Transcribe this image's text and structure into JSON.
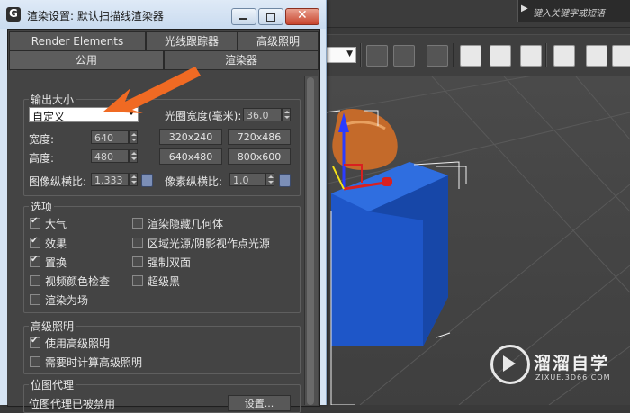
{
  "dialog": {
    "title": "渲染设置: 默认扫描线渲染器",
    "tabs_row1": [
      "Render Elements",
      "光线跟踪器",
      "高级照明"
    ],
    "tabs_row2": [
      "公用",
      "渲染器"
    ]
  },
  "output_size": {
    "group_title": "输出大小",
    "preset": "自定义",
    "aperture_label": "光圈宽度(毫米):",
    "aperture_value": "36.0",
    "width_label": "宽度:",
    "width_value": "640",
    "height_label": "高度:",
    "height_value": "480",
    "presets": [
      "320x240",
      "720x486",
      "640x480",
      "800x600"
    ],
    "image_aspect_label": "图像纵横比:",
    "image_aspect_value": "1.333",
    "pixel_aspect_label": "像素纵横比:",
    "pixel_aspect_value": "1.0"
  },
  "options": {
    "group_title": "选项",
    "left": [
      {
        "label": "大气",
        "checked": true
      },
      {
        "label": "效果",
        "checked": true
      },
      {
        "label": "置换",
        "checked": true
      },
      {
        "label": "视频颜色检查",
        "checked": false
      },
      {
        "label": "渲染为场",
        "checked": false
      }
    ],
    "right": [
      {
        "label": "渲染隐藏几何体",
        "checked": false
      },
      {
        "label": "区域光源/阴影视作点光源",
        "checked": false
      },
      {
        "label": "强制双面",
        "checked": false
      },
      {
        "label": "超级黑",
        "checked": false
      }
    ]
  },
  "advanced_lighting": {
    "group_title": "高级照明",
    "items": [
      {
        "label": "使用高级照明",
        "checked": true
      },
      {
        "label": "需要时计算高级照明",
        "checked": false
      }
    ]
  },
  "bitmap_proxy": {
    "group_title": "位图代理",
    "status": "位图代理已被禁用",
    "setup_button": "设置..."
  },
  "topbar": {
    "search_placeholder": "键入关键字或短语"
  },
  "watermark": {
    "title": "溜溜自学",
    "url": "ZIXUE.3D66.COM"
  },
  "colors": {
    "arrow": "#f06a23",
    "box": "#1e56c8",
    "teapot": "#c46a2a",
    "dialog_frame": "#d6e4f3"
  },
  "icons": [
    "arrow-right-icon",
    "minimize-icon",
    "maximize-icon",
    "close-icon",
    "lock-icon",
    "dropdown-arrow-icon",
    "checkbox-icon"
  ]
}
